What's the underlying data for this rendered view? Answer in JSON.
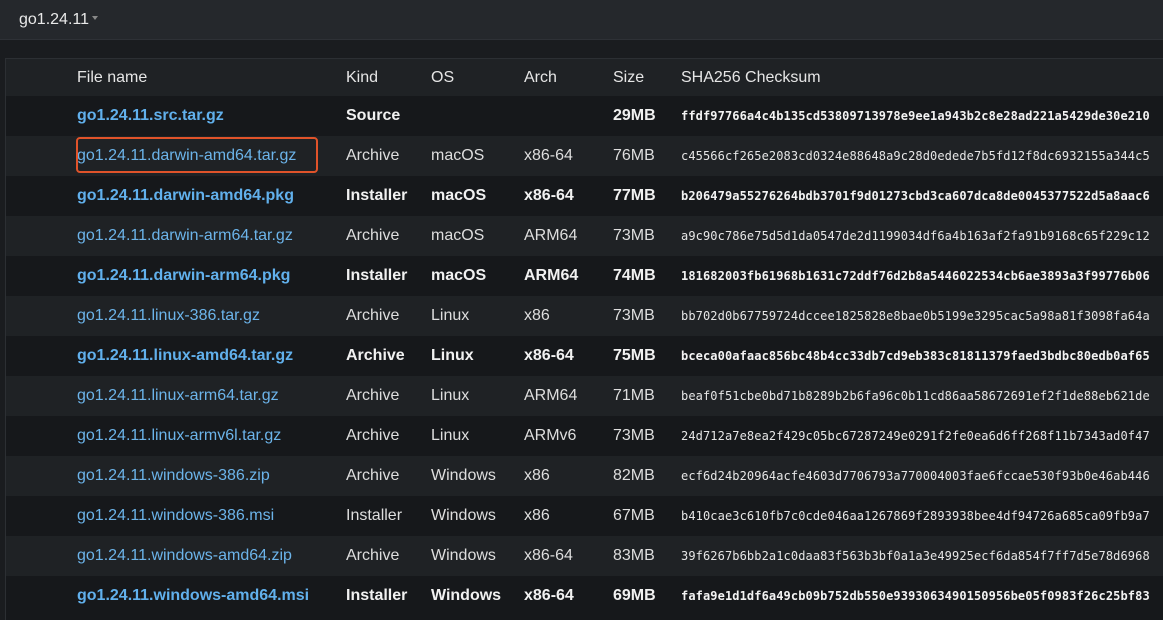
{
  "version_select": {
    "label": "go1.24.11"
  },
  "table": {
    "headers": {
      "file": "File name",
      "kind": "Kind",
      "os": "OS",
      "arch": "Arch",
      "size": "Size",
      "sha": "SHA256 Checksum"
    },
    "rows": [
      {
        "file": "go1.24.11.src.tar.gz",
        "kind": "Source",
        "os": "",
        "arch": "",
        "size": "29MB",
        "sha": "ffdf97766a4c4b135cd53809713978e9ee1a943b2c8e28ad221a5429de30e210",
        "featured": true,
        "highlighted": false
      },
      {
        "file": "go1.24.11.darwin-amd64.tar.gz",
        "kind": "Archive",
        "os": "macOS",
        "arch": "x86-64",
        "size": "76MB",
        "sha": "c45566cf265e2083cd0324e88648a9c28d0edede7b5fd12f8dc6932155a344c5",
        "featured": false,
        "highlighted": true
      },
      {
        "file": "go1.24.11.darwin-amd64.pkg",
        "kind": "Installer",
        "os": "macOS",
        "arch": "x86-64",
        "size": "77MB",
        "sha": "b206479a55276264bdb3701f9d01273cbd3ca607dca8de0045377522d5a8aac6",
        "featured": true,
        "highlighted": false
      },
      {
        "file": "go1.24.11.darwin-arm64.tar.gz",
        "kind": "Archive",
        "os": "macOS",
        "arch": "ARM64",
        "size": "73MB",
        "sha": "a9c90c786e75d5d1da0547de2d1199034df6a4b163af2fa91b9168c65f229c12",
        "featured": false,
        "highlighted": false
      },
      {
        "file": "go1.24.11.darwin-arm64.pkg",
        "kind": "Installer",
        "os": "macOS",
        "arch": "ARM64",
        "size": "74MB",
        "sha": "181682003fb61968b1631c72ddf76d2b8a5446022534cb6ae3893a3f99776b06",
        "featured": true,
        "highlighted": false
      },
      {
        "file": "go1.24.11.linux-386.tar.gz",
        "kind": "Archive",
        "os": "Linux",
        "arch": "x86",
        "size": "73MB",
        "sha": "bb702d0b67759724dccee1825828e8bae0b5199e3295cac5a98a81f3098fa64a",
        "featured": false,
        "highlighted": false
      },
      {
        "file": "go1.24.11.linux-amd64.tar.gz",
        "kind": "Archive",
        "os": "Linux",
        "arch": "x86-64",
        "size": "75MB",
        "sha": "bceca00afaac856bc48b4cc33db7cd9eb383c81811379faed3bdbc80edb0af65",
        "featured": true,
        "highlighted": false
      },
      {
        "file": "go1.24.11.linux-arm64.tar.gz",
        "kind": "Archive",
        "os": "Linux",
        "arch": "ARM64",
        "size": "71MB",
        "sha": "beaf0f51cbe0bd71b8289b2b6fa96c0b11cd86aa58672691ef2f1de88eb621de",
        "featured": false,
        "highlighted": false
      },
      {
        "file": "go1.24.11.linux-armv6l.tar.gz",
        "kind": "Archive",
        "os": "Linux",
        "arch": "ARMv6",
        "size": "73MB",
        "sha": "24d712a7e8ea2f429c05bc67287249e0291f2fe0ea6d6ff268f11b7343ad0f47",
        "featured": false,
        "highlighted": false
      },
      {
        "file": "go1.24.11.windows-386.zip",
        "kind": "Archive",
        "os": "Windows",
        "arch": "x86",
        "size": "82MB",
        "sha": "ecf6d24b20964acfe4603d7706793a770004003fae6fccae530f93b0e46ab446",
        "featured": false,
        "highlighted": false
      },
      {
        "file": "go1.24.11.windows-386.msi",
        "kind": "Installer",
        "os": "Windows",
        "arch": "x86",
        "size": "67MB",
        "sha": "b410cae3c610fb7c0cde046aa1267869f2893938bee4df94726a685ca09fb9a7",
        "featured": false,
        "highlighted": false
      },
      {
        "file": "go1.24.11.windows-amd64.zip",
        "kind": "Archive",
        "os": "Windows",
        "arch": "x86-64",
        "size": "83MB",
        "sha": "39f6267b6bb2a1c0daa83f563b3bf0a1a3e49925ecf6da854f7ff7d5e78d6968",
        "featured": false,
        "highlighted": false
      },
      {
        "file": "go1.24.11.windows-amd64.msi",
        "kind": "Installer",
        "os": "Windows",
        "arch": "x86-64",
        "size": "69MB",
        "sha": "fafa9e1d1df6a49cb09b752db550e9393063490150956be05f0983f26c25bf83",
        "featured": true,
        "highlighted": false
      }
    ]
  },
  "colors": {
    "link": "#6cb4ea",
    "highlight_border": "#e0532a",
    "row_stripe": "#1f2225",
    "background": "#16181b"
  }
}
